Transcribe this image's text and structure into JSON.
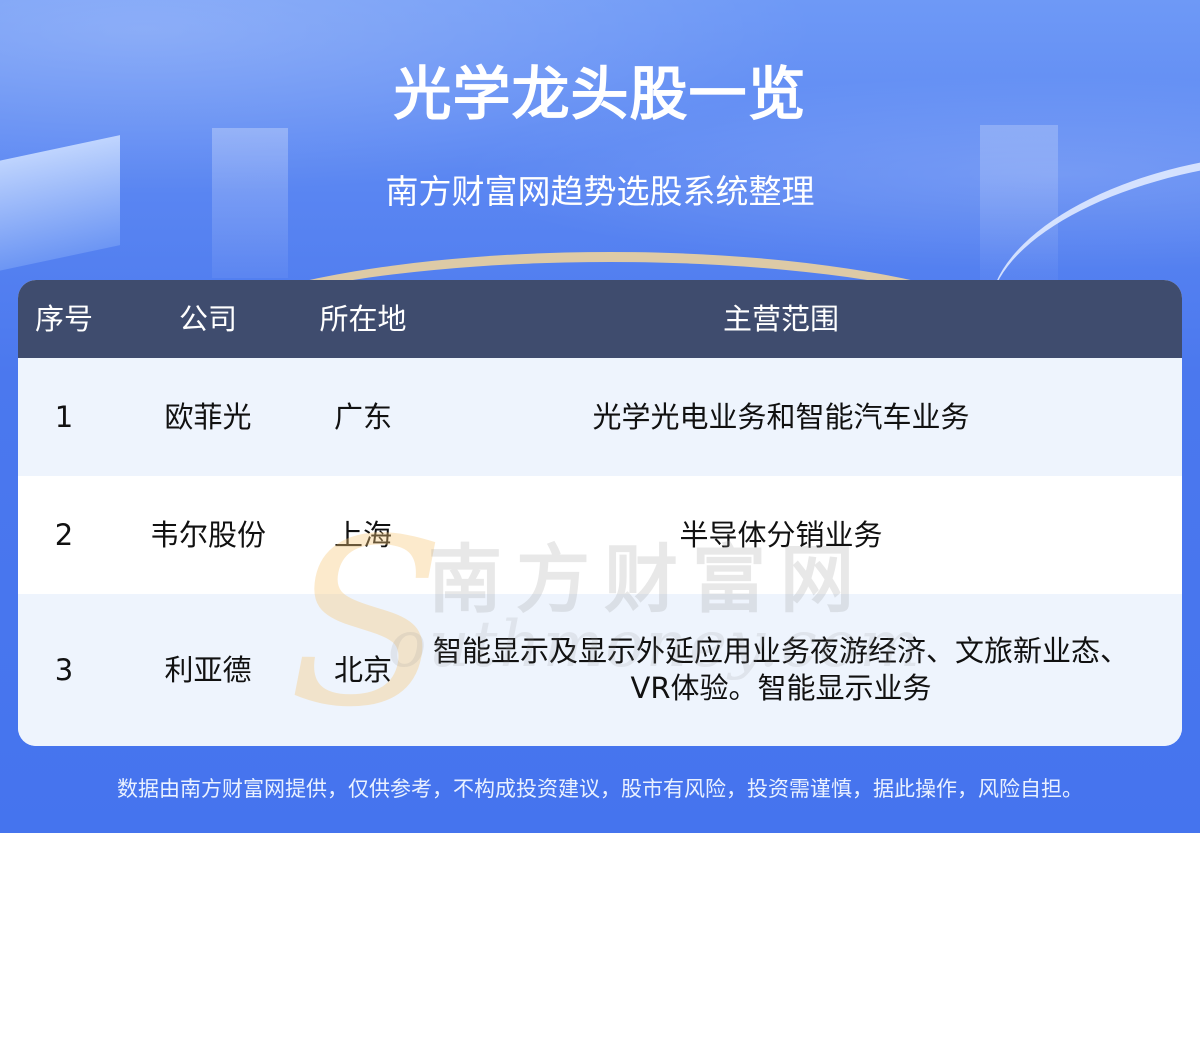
{
  "header": {
    "title": "光学龙头股一览",
    "subtitle": "南方财富网趋势选股系统整理"
  },
  "table": {
    "columns": [
      "序号",
      "公司",
      "所在地",
      "主营范围"
    ],
    "rows": [
      {
        "index": "1",
        "company": "欧菲光",
        "location": "广东",
        "business": "光学光电业务和智能汽车业务"
      },
      {
        "index": "2",
        "company": "韦尔股份",
        "location": "上海",
        "business": "半导体分销业务"
      },
      {
        "index": "3",
        "company": "利亚德",
        "location": "北京",
        "business": "智能显示及显示外延应用业务夜游经济、文旅新业态、VR体验。智能显示业务"
      }
    ]
  },
  "watermark": {
    "logo_letter": "S",
    "brand_cn": "南方财富网",
    "brand_en": "outhmoney.com"
  },
  "footer": {
    "disclaimer": "数据由南方财富网提供，仅供参考，不构成投资建议，股市有风险，投资需谨慎，据此操作，风险自担。"
  },
  "colors": {
    "background_blue": "#4574ee",
    "table_header": "#3f4c6e",
    "row_alt": "#eef4fd"
  }
}
